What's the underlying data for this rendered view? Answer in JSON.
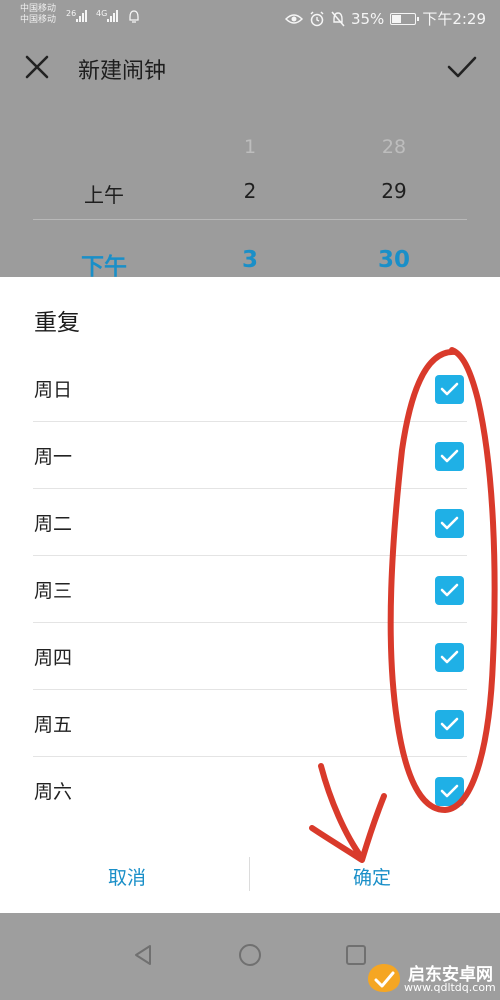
{
  "status_bar": {
    "carrier_1": "中国移动",
    "carrier_2": "中国移动",
    "net_1": "26",
    "net_2": "4G",
    "battery_percent": "35%",
    "time": "下午2:29",
    "battery_level": 0.35
  },
  "header": {
    "title": "新建闹钟"
  },
  "time_picker": {
    "period_above": "上午",
    "period_selected": "下午",
    "hour_faint": "1",
    "hour_above": "2",
    "hour_selected": "3",
    "minute_faint": "28",
    "minute_above": "29",
    "minute_selected": "30"
  },
  "repeat_dialog": {
    "title": "重复",
    "days": [
      {
        "label": "周日",
        "checked": true
      },
      {
        "label": "周一",
        "checked": true
      },
      {
        "label": "周二",
        "checked": true
      },
      {
        "label": "周三",
        "checked": true
      },
      {
        "label": "周四",
        "checked": true
      },
      {
        "label": "周五",
        "checked": true
      },
      {
        "label": "周六",
        "checked": true
      }
    ],
    "cancel_label": "取消",
    "ok_label": "确定"
  },
  "watermark": {
    "name": "启东安卓网",
    "url": "www.qdltdq.com"
  },
  "colors": {
    "accent": "#1a8fc8",
    "checkbox": "#1fb0e6",
    "annotation": "#d93a2b"
  }
}
